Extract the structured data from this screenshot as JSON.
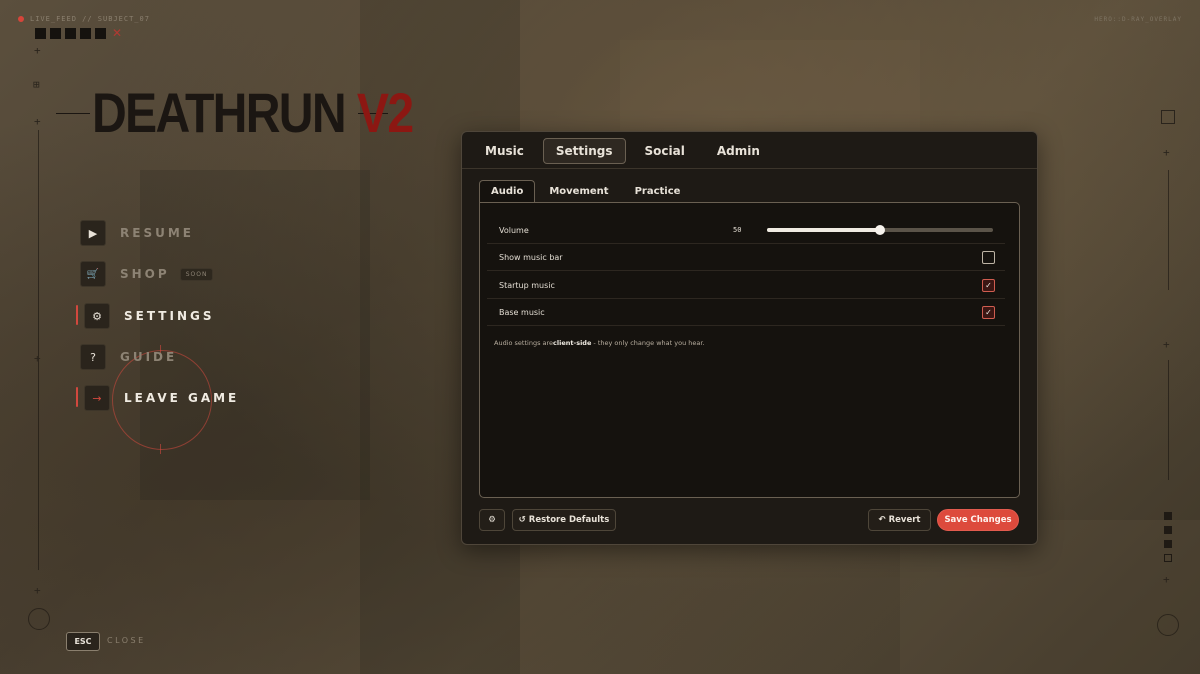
{
  "hud": {
    "feed_label": "LIVE_FEED // SUBJECT_07",
    "overlay_label": "HERO::D-RAY_OVERLAY",
    "close_mark": "✕"
  },
  "logo": {
    "main": "DEATHRUN",
    "version": "V2"
  },
  "menu": {
    "items": [
      {
        "label": "RESUME",
        "icon": "▶",
        "icon_name": "play-icon",
        "active": false
      },
      {
        "label": "SHOP",
        "icon": "🛒",
        "icon_name": "cart-icon",
        "badge": "SOON",
        "active": false
      },
      {
        "label": "SETTINGS",
        "icon": "⚙",
        "icon_name": "gear-icon",
        "active": true
      },
      {
        "label": "GUIDE",
        "icon": "?",
        "icon_name": "question-icon",
        "active": false
      },
      {
        "label": "LEAVE GAME",
        "icon": "→",
        "icon_name": "exit-icon",
        "active": true
      }
    ]
  },
  "panel": {
    "tabs": [
      "Music",
      "Settings",
      "Social",
      "Admin"
    ],
    "active_tab": "Settings",
    "subtabs": [
      "Audio",
      "Movement",
      "Practice"
    ],
    "active_subtab": "Audio",
    "volume": {
      "label": "Volume",
      "value": "50",
      "level": 0.5
    },
    "options": [
      {
        "label": "Show music bar",
        "checked": false
      },
      {
        "label": "Startup music",
        "checked": true
      },
      {
        "label": "Base music",
        "checked": true
      }
    ],
    "note_prefix": "Audio settings are",
    "note_bold": "client-side",
    "note_suffix": " - they only change what you hear.",
    "buttons": {
      "settings_icon": "⚙",
      "restore": "↺ Restore Defaults",
      "revert": "↶ Revert",
      "save": "Save Changes"
    }
  },
  "footer": {
    "key": "ESC",
    "label": "CLOSE"
  },
  "colors": {
    "accent": "#dd4a3c",
    "logo_red": "#8c1712",
    "panel_bg": "#1e1a15"
  }
}
